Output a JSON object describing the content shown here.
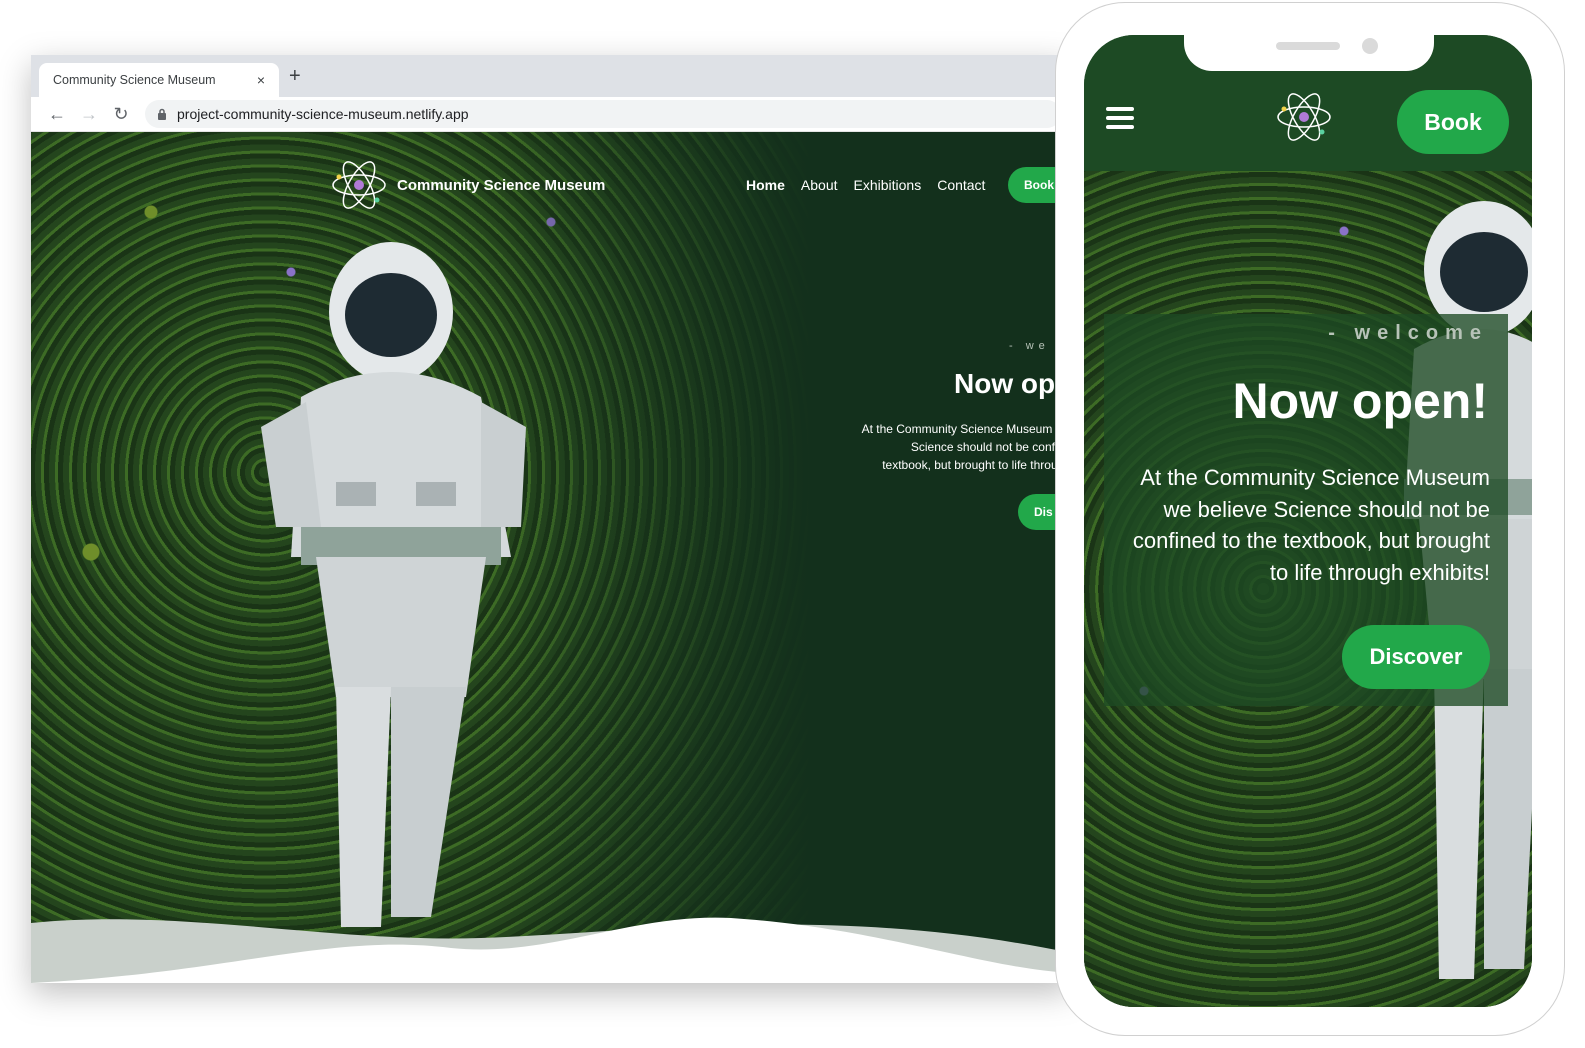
{
  "browser": {
    "tab_title": "Community Science Museum",
    "close_glyph": "×",
    "new_tab_glyph": "+",
    "back_glyph": "←",
    "forward_glyph": "→",
    "reload_glyph": "↻",
    "url": "project-community-science-museum.netlify.app"
  },
  "desktop": {
    "brand_name": "Community Science Museum",
    "nav": {
      "home": "Home",
      "about": "About",
      "exhibitions": "Exhibitions",
      "contact": "Contact",
      "book": "Book"
    },
    "hero": {
      "welcome": "- we",
      "title": "Now op",
      "text_lines": [
        "At the Community Science Museum we",
        "Science should not be confine",
        "textbook, but brought to life through"
      ],
      "discover": "Dis"
    }
  },
  "mobile": {
    "book": "Book",
    "hero": {
      "welcome": "- welcome",
      "title": "Now open!",
      "text": "At the Community Science Museum we believe Science should not be confined to the textbook, but brought to life through exhibits!",
      "discover": "Discover"
    }
  },
  "colors": {
    "brand_green": "#22a84a",
    "dark_green": "#13301c",
    "header_green": "#1d4a24"
  }
}
